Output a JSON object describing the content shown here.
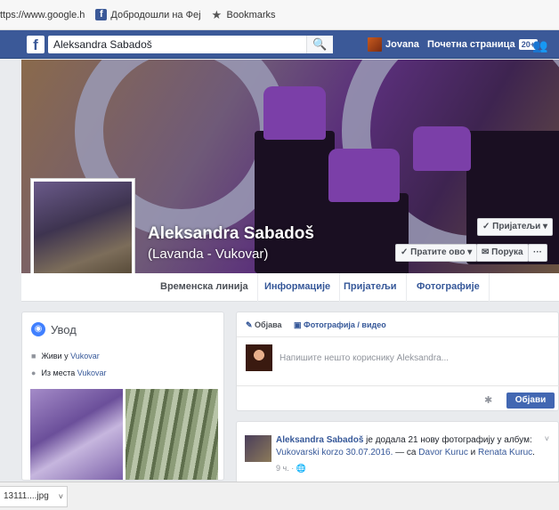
{
  "bookmarks": [
    {
      "label": "ttps://www.google.h",
      "icon": "google-icon"
    },
    {
      "label": "Добродошли на Феј",
      "icon": "facebook-icon"
    },
    {
      "label": "Bookmarks",
      "icon": "star-icon"
    }
  ],
  "fbbar": {
    "logo": "f",
    "search_value": "Aleksandra Sabadoš",
    "search_icon": "🔍",
    "user_name": "Jovana",
    "home_label": "Почетна страница",
    "home_badge": "20+",
    "friends_icon": "👥"
  },
  "profile": {
    "name": "Aleksandra Sabadoš",
    "alt_name": "(Lavanda - Vukovar)",
    "friends_button": "✓ Пријатељи ▾",
    "follow_button": "✓ Пратите ово ▾",
    "message_button": "✉ Порука",
    "more_button": "···"
  },
  "tabs": [
    "Временска линија",
    "Информације",
    "Пријатељи",
    "Фотографије"
  ],
  "intro": {
    "title": "Увод",
    "lives_prefix": "Живи у ",
    "lives_link": "Vukovar",
    "from_prefix": "Из места ",
    "from_link": "Vukovar"
  },
  "composer": {
    "status_label": "Објава",
    "photo_label": "Фотографија / видео",
    "placeholder": "Напишите нешто кориснику Aleksandra...",
    "post_button": "Објави"
  },
  "post": {
    "author": "Aleksandra Sabadoš",
    "action": " је додала 21 нову фотографију у албум: ",
    "album": "Vukovarski korzo 30.07.2016.",
    "with": " — са ",
    "friend1": "Davor Kuruc",
    "and": " и ",
    "friend2": "Renata Kuruc",
    "end": ".",
    "time": "9 ч. · ",
    "privacy_icon": "🌐"
  },
  "download": {
    "filename": "13111....jpg",
    "chevron": "˅"
  }
}
